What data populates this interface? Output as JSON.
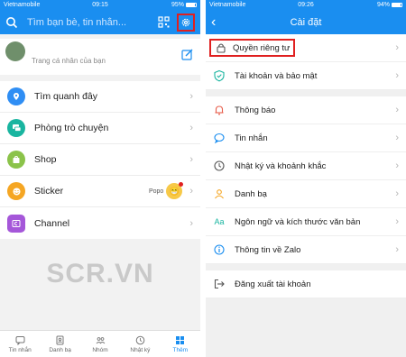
{
  "left": {
    "status": {
      "carrier": "Vietnamobile",
      "time": "09:15",
      "battery": "95%"
    },
    "search": {
      "placeholder": "Tìm bạn bè, tin nhắn..."
    },
    "profile": {
      "caption": "Trang cá nhân của bạn"
    },
    "menu": [
      {
        "label": "Tìm quanh đây",
        "icon": "location-icon",
        "color": "#2f8ef4"
      },
      {
        "label": "Phòng trò chuyện",
        "icon": "chat-rooms-icon",
        "color": "#19b5a0"
      },
      {
        "label": "Shop",
        "icon": "shop-icon",
        "color": "#8bc34a"
      },
      {
        "label": "Sticker",
        "icon": "sticker-icon",
        "color": "#f5a623",
        "badge": "Popo"
      },
      {
        "label": "Channel",
        "icon": "channel-icon",
        "color": "#a557d9"
      }
    ],
    "watermark": "SCR.VN",
    "tabs": [
      {
        "label": "Tin nhắn",
        "icon": "message-icon"
      },
      {
        "label": "Danh bạ",
        "icon": "contacts-icon"
      },
      {
        "label": "Nhóm",
        "icon": "group-icon"
      },
      {
        "label": "Nhật ký",
        "icon": "clock-icon"
      },
      {
        "label": "Thêm",
        "icon": "grid-icon",
        "active": true
      }
    ]
  },
  "right": {
    "status": {
      "carrier": "Vietnamobile",
      "time": "09:26",
      "battery": "94%"
    },
    "title": "Cài đặt",
    "groups": [
      [
        {
          "label": "Quyền riêng tư",
          "icon": "lock-icon",
          "highlighted": true
        },
        {
          "label": "Tài khoản và bảo mật",
          "icon": "shield-icon"
        }
      ],
      [
        {
          "label": "Thông báo",
          "icon": "bell-icon"
        },
        {
          "label": "Tin nhắn",
          "icon": "chat-icon"
        },
        {
          "label": "Nhật ký và khoảnh khắc",
          "icon": "clock-icon"
        },
        {
          "label": "Danh bạ",
          "icon": "person-icon"
        },
        {
          "label": "Ngôn ngữ và kích thước văn bản",
          "icon": "language-icon"
        },
        {
          "label": "Thông tin về Zalo",
          "icon": "info-icon"
        }
      ],
      [
        {
          "label": "Đăng xuất tài khoản",
          "icon": "logout-icon"
        }
      ]
    ]
  },
  "colors": {
    "brand": "#1a8ef0",
    "highlight": "#e02020"
  }
}
